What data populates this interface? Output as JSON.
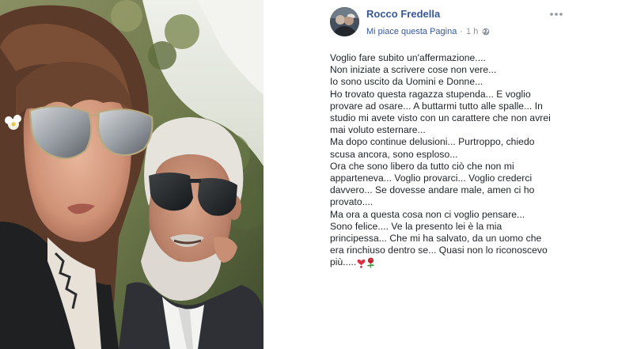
{
  "post": {
    "author": "Rocco Fredella",
    "like_page": "Mi piace questa Pagina",
    "separator": "·",
    "time": "1 h",
    "visibility_icon": "globe-icon",
    "more_icon": "more-options-icon",
    "lines": [
      "Voglio fare subito un'affermazione....",
      "Non iniziate a scrivere cose non vere...",
      "Io sono uscito da Uomini e Donne...",
      "Ho trovato questa ragazza stupenda... E voglio",
      "provare ad osare... A buttarmi tutto alle spalle... In",
      "studio mi avete visto con un carattere che non avrei",
      "mai voluto esternare...",
      "Ma dopo continue delusioni... Purtroppo, chiedo",
      "scusa ancora, sono esploso...",
      "Ora che sono libero da tutto ciò che non mi",
      "apparteneva... Voglio provarci... Voglio crederci",
      "davvero... Se dovesse andare male, amen ci ho",
      "provato....",
      "Ma ora a questa cosa non ci voglio pensare...",
      "Sono felice.... Ve la presento lei è la mia",
      "principessa... Che mi ha salvato, da un uomo che",
      "era rinchiuso dentro se... Quasi non lo riconoscevo"
    ],
    "last_line": "più.....",
    "emojis": [
      "heart-exclamation-icon",
      "rose-icon"
    ]
  },
  "photo": {
    "description_icon": "couple-selfie-photo"
  }
}
